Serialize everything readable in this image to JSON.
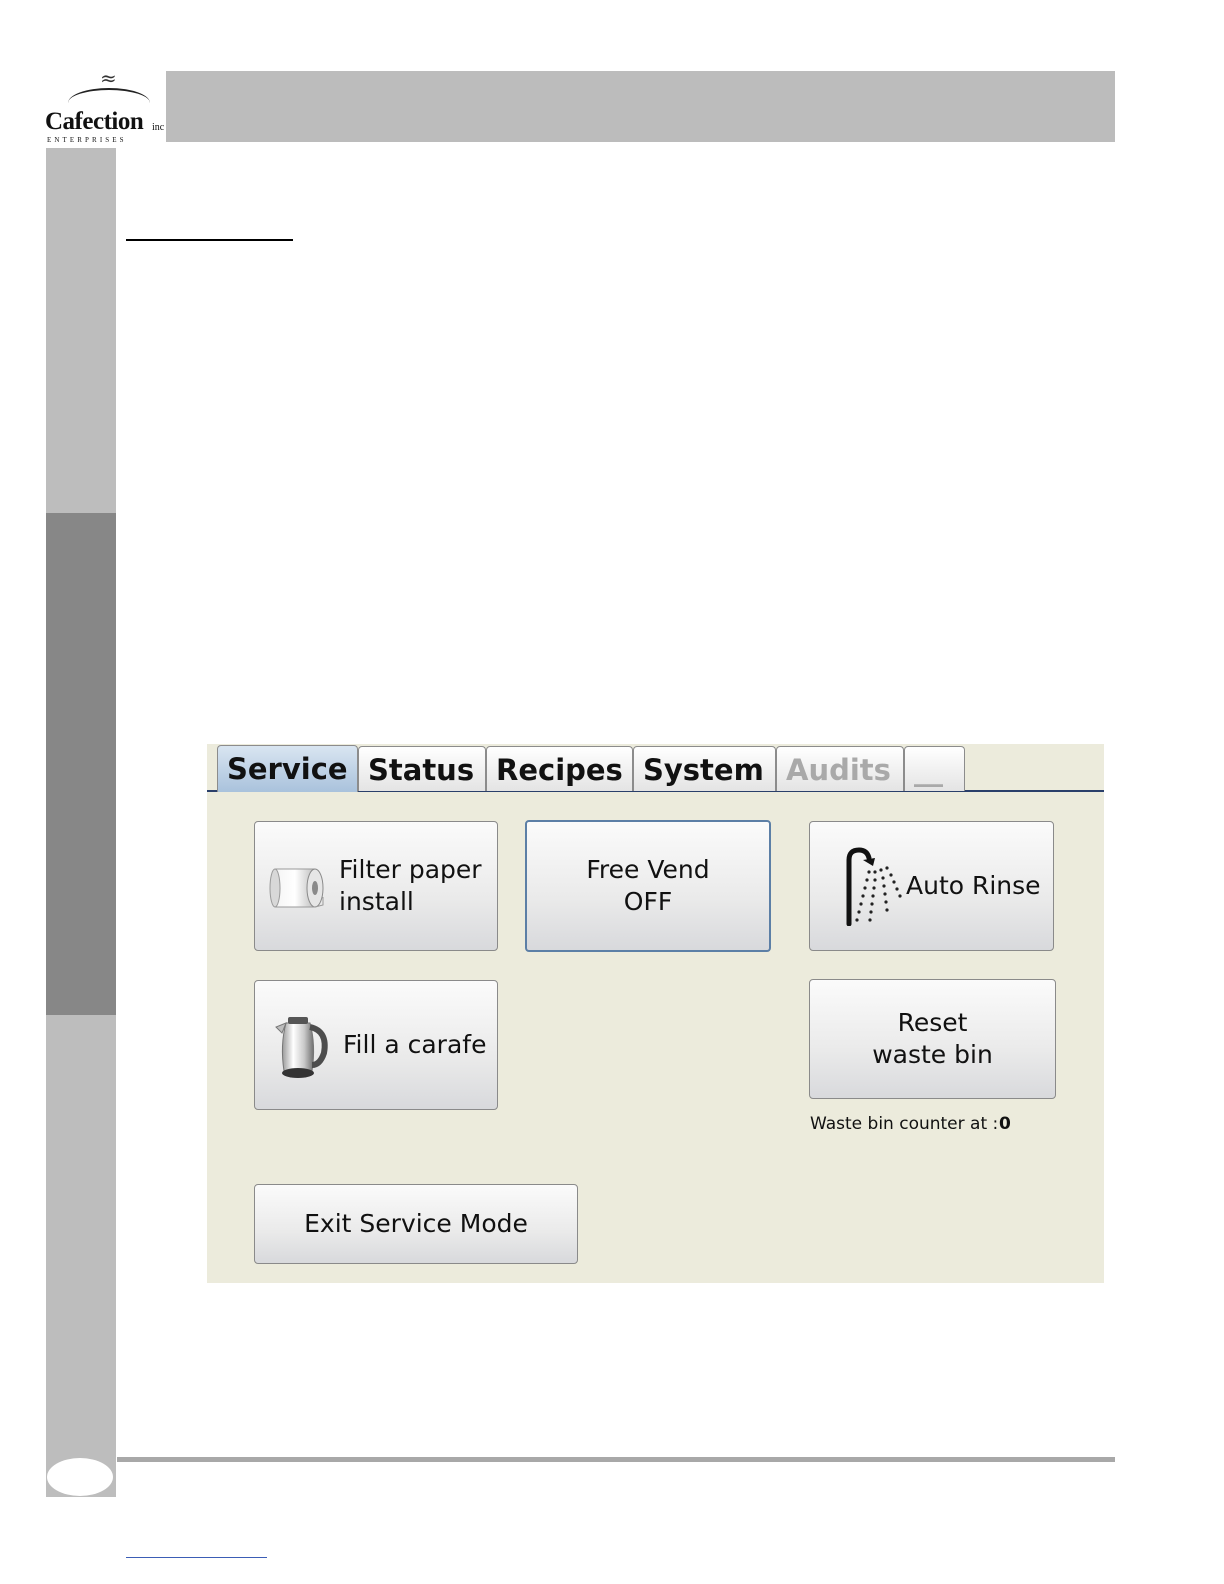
{
  "logo": {
    "wordmark": "Cafection",
    "suffix": "inc",
    "subtitle": "ENTERPRISES"
  },
  "screen": {
    "tabs": [
      {
        "label": "Service",
        "state": "active"
      },
      {
        "label": "Status",
        "state": "normal"
      },
      {
        "label": "Recipes",
        "state": "normal"
      },
      {
        "label": "System",
        "state": "normal"
      },
      {
        "label": "Audits",
        "state": "disabled"
      },
      {
        "label": "__",
        "state": "disabled"
      }
    ],
    "buttons": {
      "filter_paper": {
        "line1": "Filter paper",
        "line2": "install",
        "icon": "paper-roll-icon"
      },
      "free_vend": {
        "line1": "Free Vend",
        "line2": "OFF"
      },
      "auto_rinse": {
        "label": "Auto Rinse",
        "icon": "shower-icon"
      },
      "fill_carafe": {
        "label": "Fill a carafe",
        "icon": "kettle-icon"
      },
      "reset_waste": {
        "line1": "Reset",
        "line2": "waste bin"
      },
      "exit_service": {
        "label": "Exit Service Mode"
      }
    },
    "waste_counter": {
      "label": "Waste bin counter at :",
      "value": "0"
    },
    "colors": {
      "screen_bg": "#ecebdc",
      "active_tab": "#a9c2dc",
      "tab_line": "#2a3f6a",
      "disabled_text": "#a9a9a9"
    }
  }
}
